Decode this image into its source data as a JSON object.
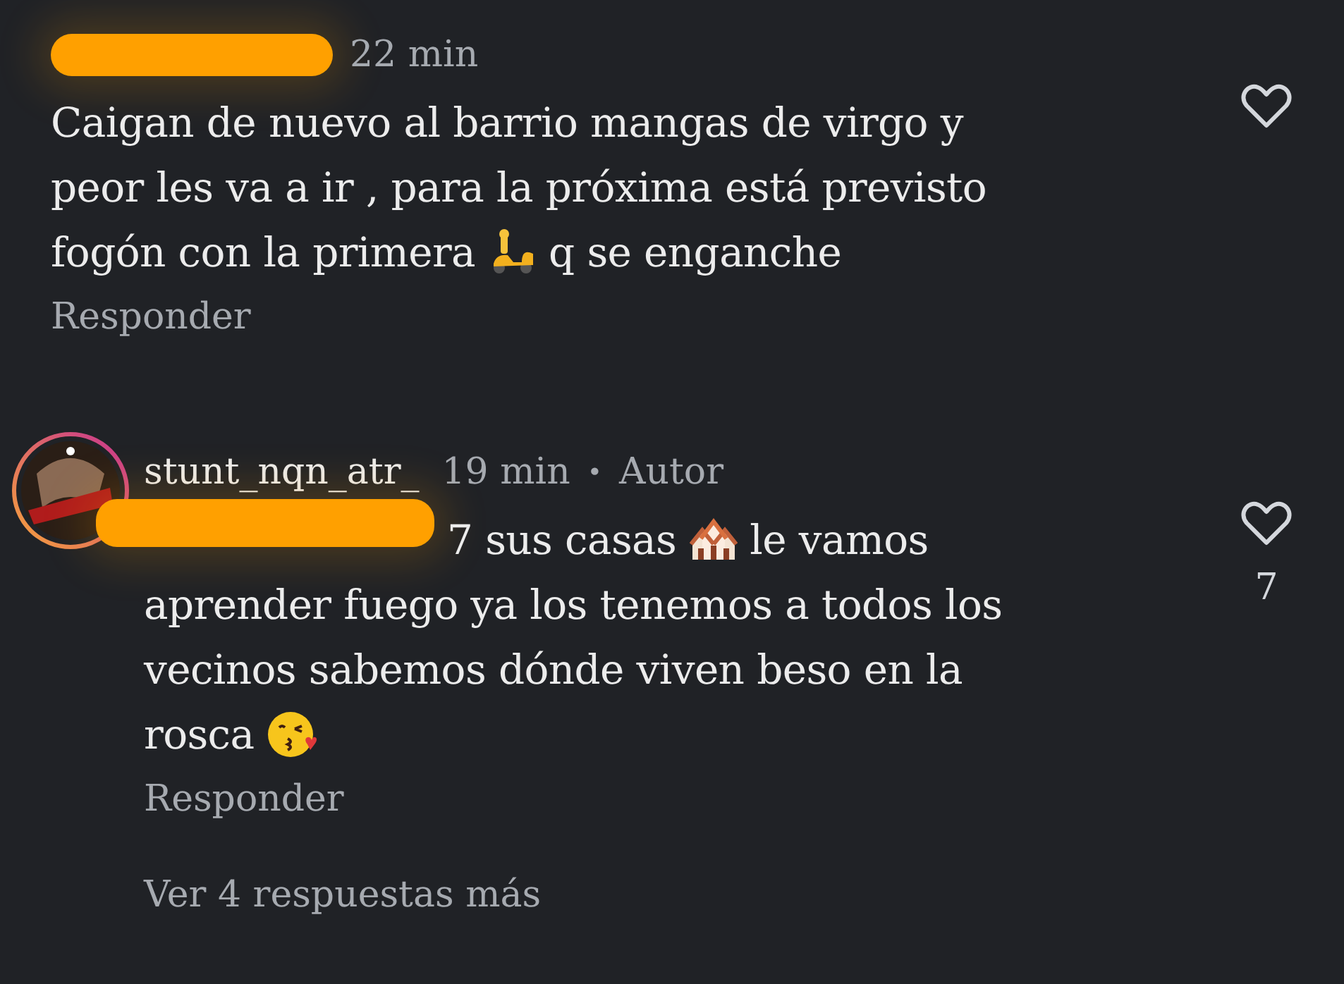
{
  "comments": [
    {
      "avatar": false,
      "meta": [
        {
          "kind": "redaction"
        },
        {
          "kind": "time",
          "text": "22 min"
        }
      ],
      "lines": [
        [
          {
            "kind": "text",
            "text": "Caigan de nuevo al barrio mangas de virgo y"
          }
        ],
        [
          {
            "kind": "text",
            "text": "peor les va a ir , para la próxima está previsto"
          }
        ],
        [
          {
            "kind": "text",
            "text": "fogón con la primera"
          },
          {
            "kind": "scooter"
          },
          {
            "kind": "text",
            "text": "q se enganche"
          }
        ]
      ],
      "reply_link": "Responder",
      "liked": false
    },
    {
      "avatar": true,
      "meta": [
        {
          "kind": "author",
          "text": "stunt_nqn_atr_"
        },
        {
          "kind": "time",
          "text": "19 min"
        },
        {
          "kind": "dot",
          "text": "•"
        },
        {
          "kind": "time",
          "text": "Autor"
        }
      ],
      "lines": [
        [
          {
            "kind": "redaction"
          },
          {
            "kind": "text",
            "text": "7 sus casas"
          },
          {
            "kind": "houses"
          },
          {
            "kind": "text",
            "text": "le vamos"
          }
        ],
        [
          {
            "kind": "text",
            "text": "aprender fuego ya los tenemos a todos los"
          }
        ],
        [
          {
            "kind": "text",
            "text": "vecinos sabemos dónde viven beso en la"
          }
        ],
        [
          {
            "kind": "text",
            "text": "rosca"
          },
          {
            "kind": "kiss"
          }
        ]
      ],
      "reply_link": "Responder",
      "liked": false,
      "like_count": "7",
      "more_replies": "Ver 4 respuestas más"
    }
  ]
}
